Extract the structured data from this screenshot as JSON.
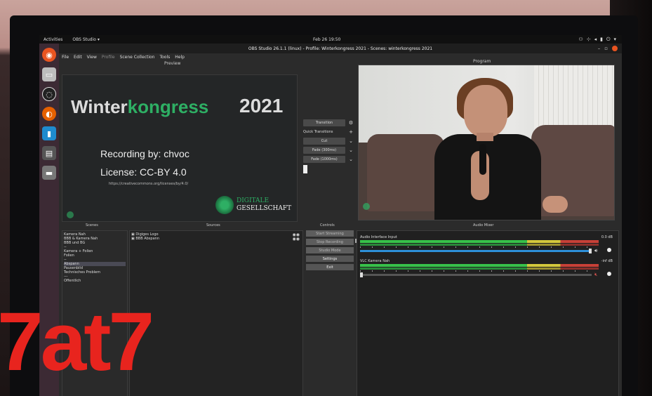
{
  "topbar": {
    "activities": "Activities",
    "app": "OBS Studio ▾",
    "clock": "Feb 26 19:50",
    "tray": [
      "⚇",
      "⊹",
      "◂",
      "▮",
      "⏻",
      "▾"
    ]
  },
  "window": {
    "title": "OBS Studio 26.1.1 (linux) - Profile: Winterkongress 2021 - Scenes: winterkongress 2021"
  },
  "menu": [
    "File",
    "Edit",
    "View",
    "Profile",
    "Scene Collection",
    "Tools",
    "Help"
  ],
  "labels": {
    "preview": "Preview",
    "program": "Program",
    "scenes": "Scenes",
    "sources": "Sources",
    "controls": "Controls",
    "mixer": "Audio Mixer"
  },
  "preview": {
    "title_a": "Winter",
    "title_b": "kongress",
    "year": "2021",
    "recording": "Recording by: chvoc",
    "license": "License: CC-BY 4.0",
    "url": "https://creativecommons.org/licenses/by/4.0/",
    "logo_a": "DIGITALE",
    "logo_b": "GESELLSCHAFT"
  },
  "transitions": {
    "transition": "Transition",
    "quick": "Quick Transitions",
    "cut": "Cut",
    "fade300": "Fade (300ms)",
    "fade1000": "Fade (1000ms)"
  },
  "scenes": [
    "Kamera Nah",
    "BBB & Kamera Nah",
    "BBB und BG",
    "--",
    "Kamera + Folien",
    "Folien",
    "--",
    "Abspann",
    "Pausenbild",
    "Technisches Problem",
    "---",
    "Offentlich"
  ],
  "scene_selected": 7,
  "sources": [
    "Digiges Logo",
    "BBB Abspann"
  ],
  "controls": [
    "Start Streaming",
    "Stop Recording",
    "Studio Mode",
    "Settings",
    "Exit"
  ],
  "mixer": {
    "channels": [
      {
        "name": "Audio Interface Input",
        "db": "0.0 dB",
        "level": 0.72,
        "muted": false
      },
      {
        "name": "VLC Kamera Nah",
        "db": "-inf dB",
        "level": 0.0,
        "muted": true
      }
    ]
  },
  "watermark": "7at7",
  "colors": {
    "obs_bg": "#2b2b2b",
    "accent_green": "#2eaf64",
    "watermark_red": "#e8241e",
    "ubuntu_orange": "#e95420"
  },
  "icons": {
    "dock": [
      "firefox-like-browser-icon",
      "files-icon",
      "obs-icon",
      "firefox-icon",
      "vscode-icon",
      "terminal-icon",
      "disk-icon"
    ]
  }
}
